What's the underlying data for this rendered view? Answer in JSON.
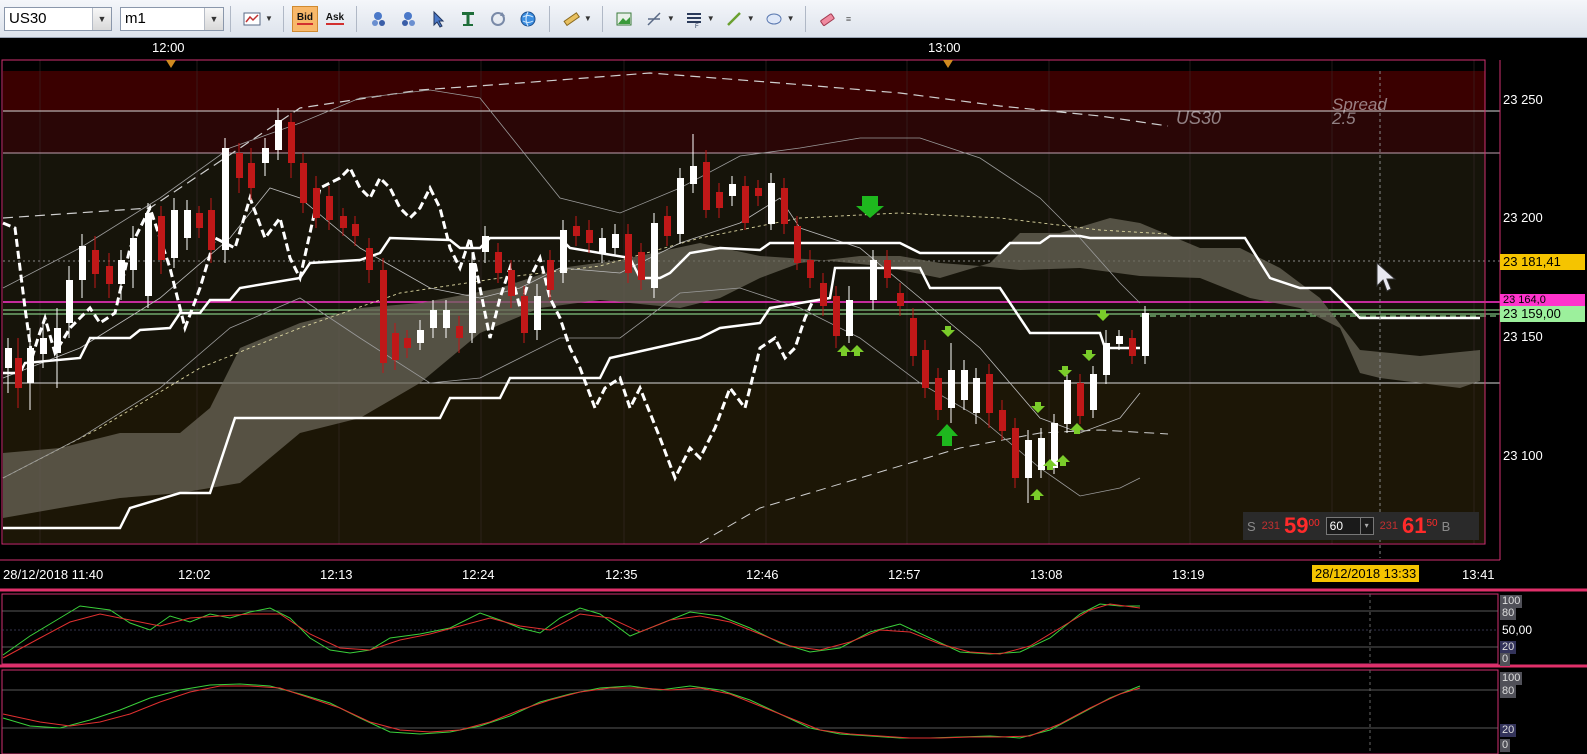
{
  "toolbar": {
    "symbol": "US30",
    "timeframe": "m1",
    "bid_label": "Bid",
    "ask_label": "Ask",
    "icons": [
      "chart-type-icon",
      "bid-icon",
      "ask-icon",
      "buy-orders-icon",
      "sell-orders-icon",
      "cursor-icon",
      "text-tool-icon",
      "refresh-icon",
      "globe-icon",
      "ruler-icon",
      "screenshot-icon",
      "crosshair-icon",
      "indicators-icon",
      "line-tool-icon",
      "shape-tool-icon",
      "eraser-icon",
      "more-icon"
    ]
  },
  "chart": {
    "instrument_label": "US30",
    "spread_label": "Spread",
    "spread_value": "2.5",
    "top_time_labels": [
      "12:00",
      "13:00"
    ],
    "bottom_time_labels": [
      "28/12/2018 11:40",
      "12:02",
      "12:13",
      "12:24",
      "12:35",
      "12:46",
      "12:57",
      "13:08",
      "13:19",
      "13:41"
    ],
    "crosshair_time": "28/12/2018 13:33",
    "price_labels": [
      "23 250",
      "23 200",
      "23 150",
      "23 100"
    ],
    "price_tags": {
      "current": "23 181,41",
      "magenta": "23 164,0",
      "bid": "23 159,00"
    },
    "colors": {
      "bull_candle": "#ffffff",
      "bear_candle": "#c01818",
      "magenta_line": "#ff33cc",
      "green_line": "#9cf09c",
      "price_tag_current": "#f5c400",
      "frame": "#d03070"
    }
  },
  "trade_panel": {
    "sell_label": "S",
    "sell_prefix": "231",
    "sell_big": "59",
    "sell_sup": "00",
    "lot": "60",
    "buy_prefix": "231",
    "buy_big": "61",
    "buy_sup": "50",
    "buy_label": "B"
  },
  "oscillator1": {
    "levels": [
      "100",
      "80",
      "50,00",
      "20",
      "0"
    ]
  },
  "oscillator2": {
    "levels": [
      "100",
      "80",
      "20",
      "0"
    ]
  },
  "chart_data": {
    "type": "line",
    "title": "",
    "series": [
      {
        "name": "",
        "values": [
          23140,
          23160,
          23175,
          23190,
          23200,
          23220,
          23235,
          23245,
          23200,
          23190,
          23140,
          23145,
          23170,
          23185,
          23175,
          23200,
          23215,
          23195,
          23210,
          23200,
          23190,
          23175,
          23165,
          23160,
          23150,
          23130,
          23120,
          23120,
          23110,
          23100,
          23100,
          23120,
          23140,
          23150,
          23155,
          23150,
          23159
        ]
      }
    ],
    "ylim": [
      23075,
      23270
    ]
  }
}
